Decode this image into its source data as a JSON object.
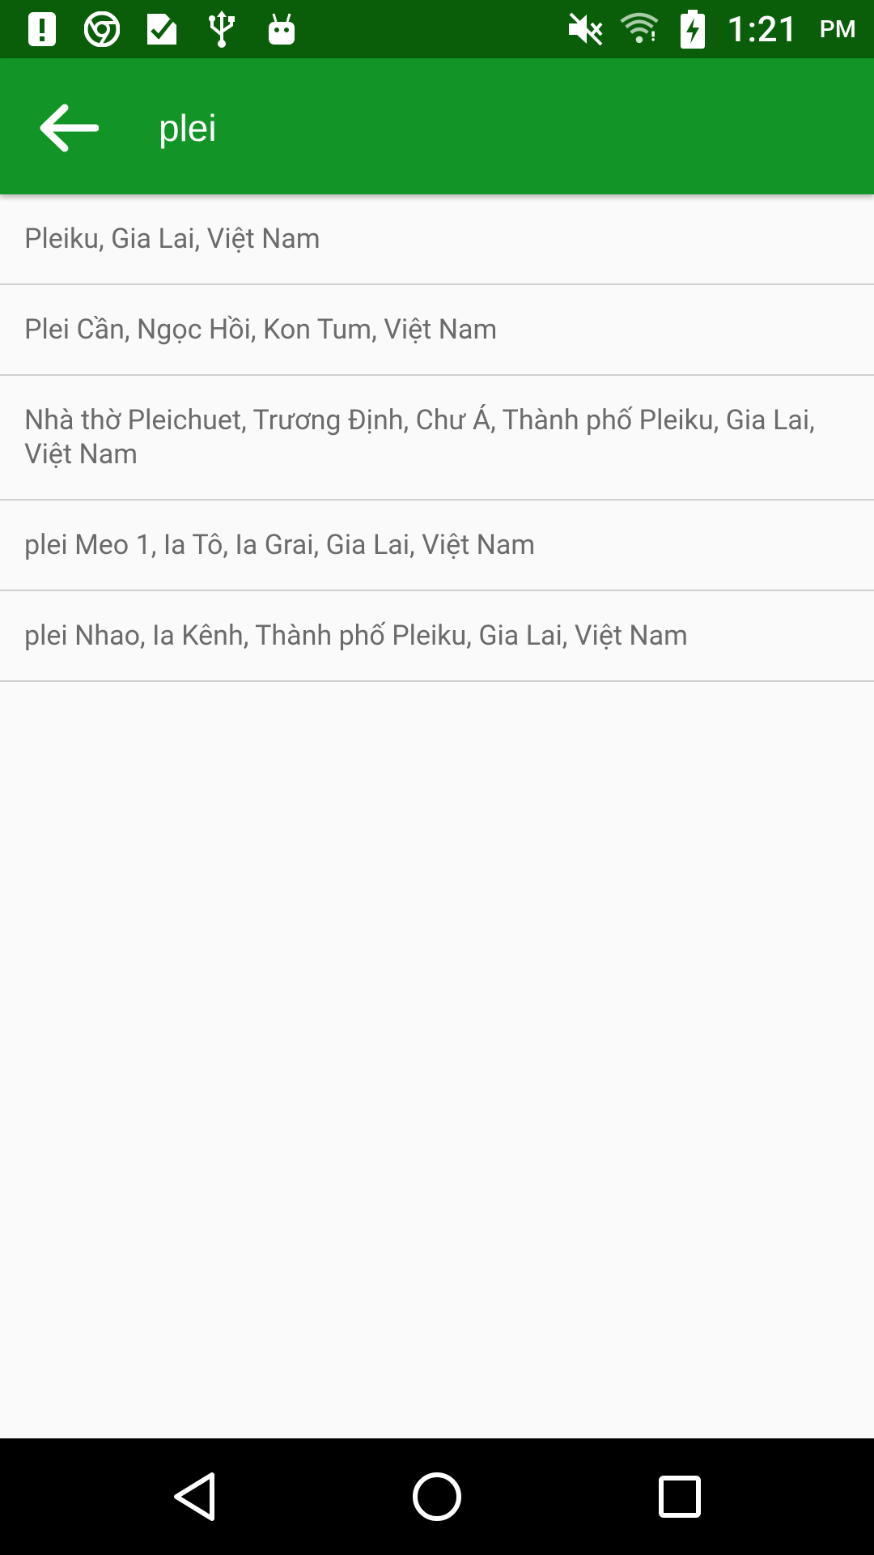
{
  "status_bar": {
    "time": "1:21",
    "ampm": "PM",
    "left_icons": [
      "alert-icon",
      "chrome-icon",
      "download-check-icon",
      "usb-icon",
      "android-icon"
    ],
    "right_icons": [
      "mute-icon",
      "wifi-icon",
      "battery-charging-icon"
    ]
  },
  "toolbar": {
    "search_value": "plei",
    "background": "#129526"
  },
  "results": [
    {
      "label": "Pleiku, Gia Lai, Việt Nam"
    },
    {
      "label": "Plei Cần, Ngọc Hồi, Kon Tum, Việt Nam"
    },
    {
      "label": "Nhà thờ Pleichuet, Trương Định, Chư Á, Thành phố Pleiku, Gia Lai, Việt Nam"
    },
    {
      "label": "plei Meo 1, Ia Tô, Ia Grai, Gia Lai, Việt Nam"
    },
    {
      "label": "plei Nhao, Ia Kênh, Thành phố Pleiku, Gia Lai, Việt Nam"
    }
  ],
  "nav_bar": {
    "icons": [
      "back-triangle-icon",
      "home-circle-icon",
      "recents-square-icon"
    ]
  }
}
